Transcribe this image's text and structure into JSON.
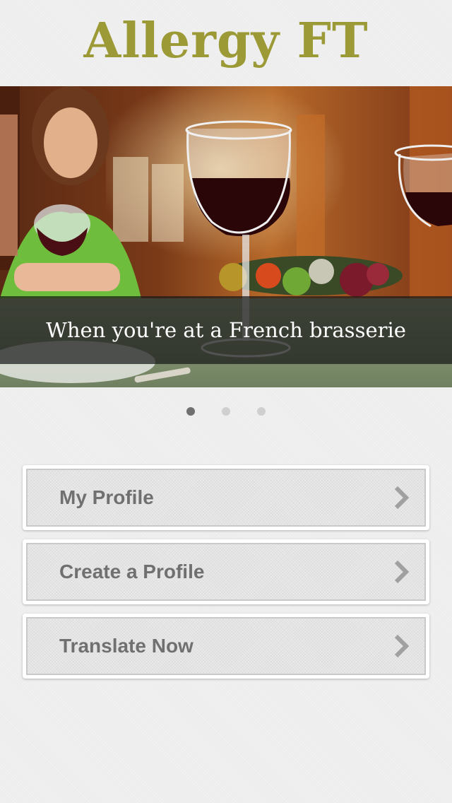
{
  "app": {
    "title": "Allergy FT"
  },
  "carousel": {
    "caption": "When you're at a French brasserie",
    "page_count": 3,
    "active_page": 1
  },
  "menu": {
    "items": [
      {
        "label": "My Profile",
        "icon": "chevron-right-icon"
      },
      {
        "label": "Create a Profile",
        "icon": "chevron-right-icon"
      },
      {
        "label": "Translate Now",
        "icon": "chevron-right-icon"
      }
    ]
  },
  "colors": {
    "title": "#9c9a37",
    "menu_text": "#707070",
    "dot_active": "#707070",
    "dot_inactive": "#cfcfcf"
  }
}
